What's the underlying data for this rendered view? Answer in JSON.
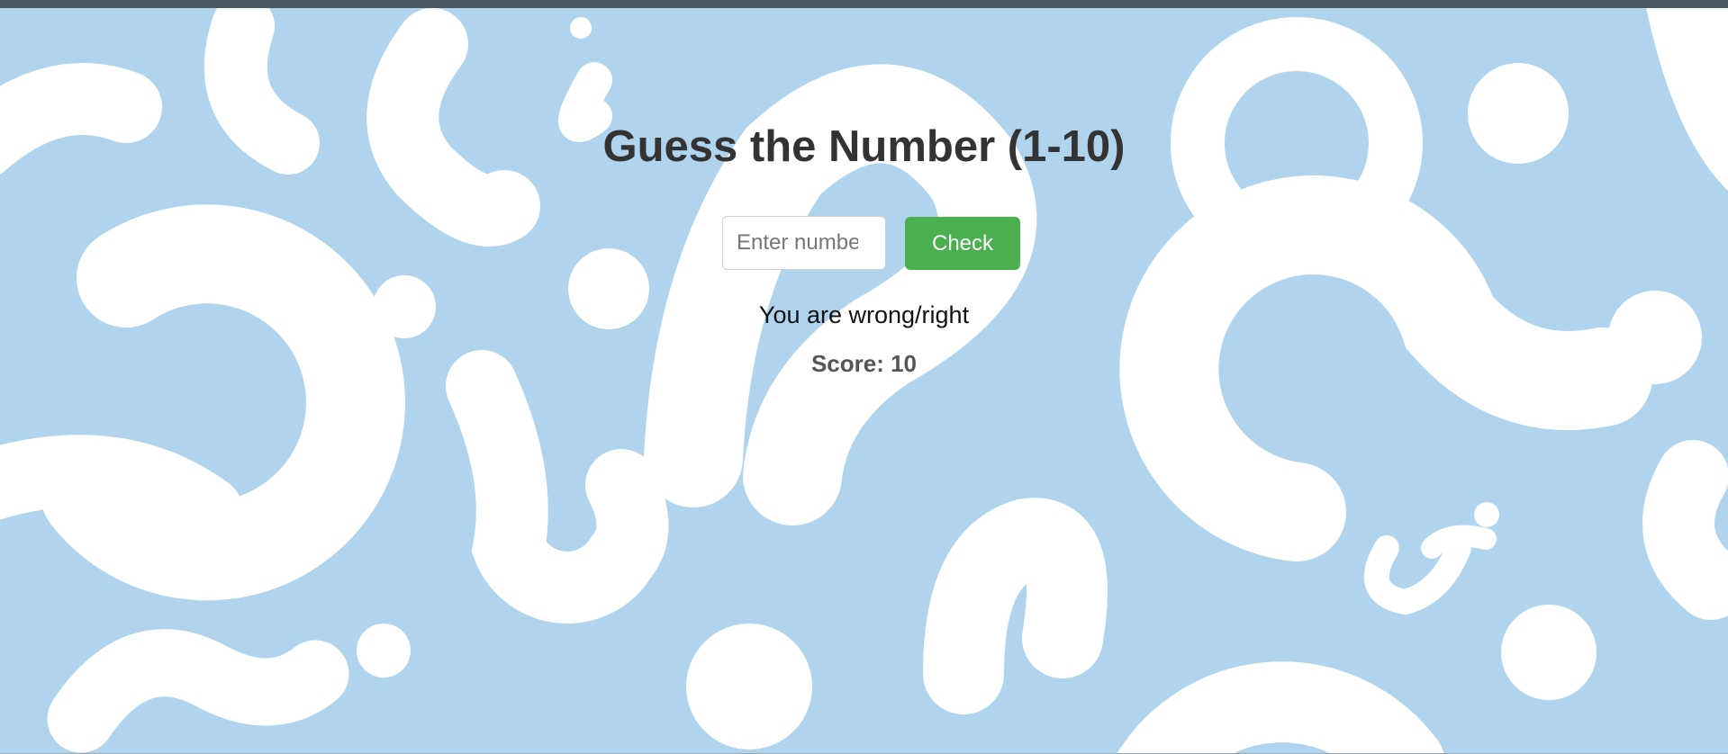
{
  "game": {
    "title": "Guess the Number (1-10)",
    "input_placeholder": "Enter number",
    "check_label": "Check",
    "message": "You are wrong/right",
    "score_text": "Score: 10"
  },
  "colors": {
    "background": "#b0d3ee",
    "pattern": "#ffffff",
    "button": "#4caf50",
    "title": "#333333",
    "topbar": "#4a5a64"
  },
  "background_pattern": "question-marks"
}
